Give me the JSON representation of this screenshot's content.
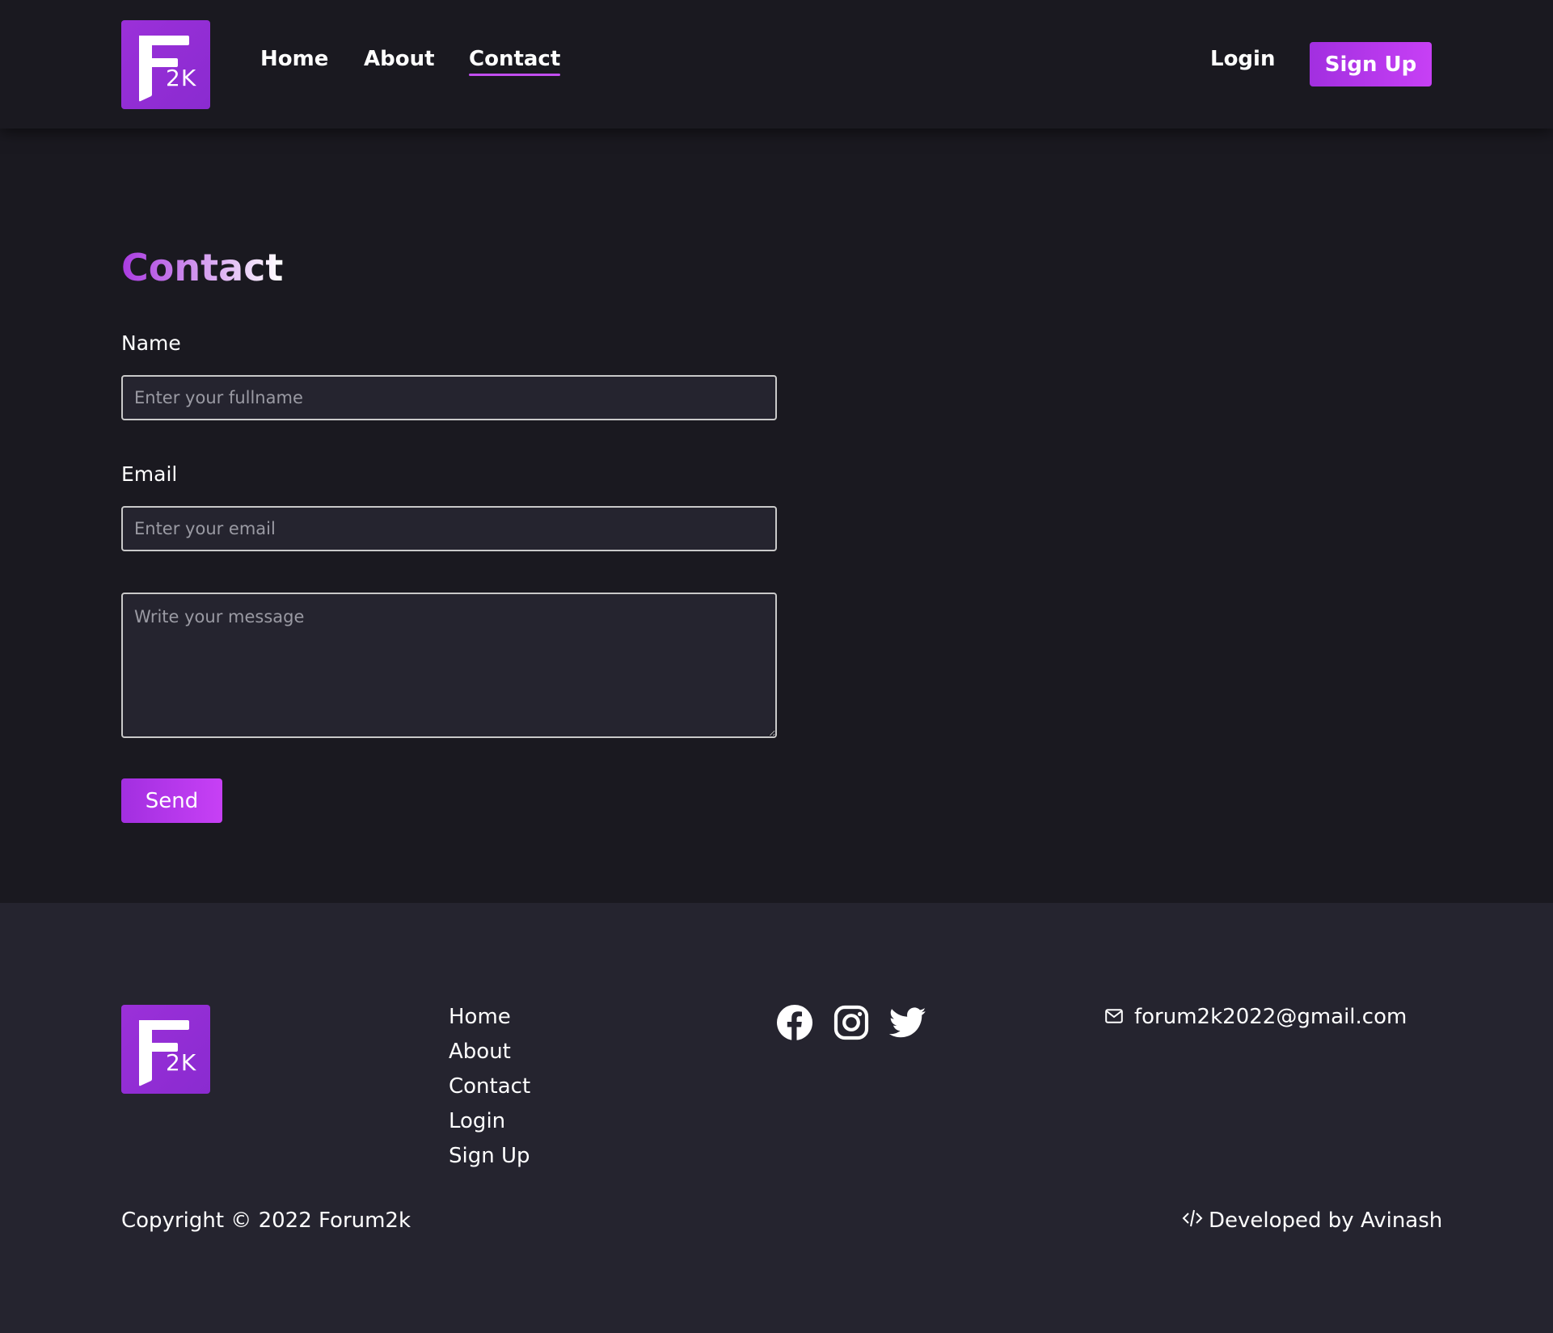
{
  "header": {
    "logo_text": "2K",
    "nav": {
      "home": "Home",
      "about": "About",
      "contact": "Contact"
    },
    "login_label": "Login",
    "signup_label": "Sign Up"
  },
  "contact_form": {
    "title": "Contact",
    "name_label": "Name",
    "name_placeholder": "Enter your fullname",
    "email_label": "Email",
    "email_placeholder": "Enter your email",
    "message_placeholder": "Write your message",
    "send_label": "Send"
  },
  "footer": {
    "logo_text": "2K",
    "links": [
      "Home",
      "About",
      "Contact",
      "Login",
      "Sign Up"
    ],
    "social_icons": [
      "facebook-icon",
      "instagram-icon",
      "twitter-icon"
    ],
    "email": "forum2k2022@gmail.com",
    "copyright": "Copyright © 2022 Forum2k",
    "developer": "Developed by Avinash"
  },
  "colors": {
    "background": "#1a1920",
    "footer_background": "#25242f",
    "accent": "#b13ae8",
    "logo": "#9b30d9"
  }
}
